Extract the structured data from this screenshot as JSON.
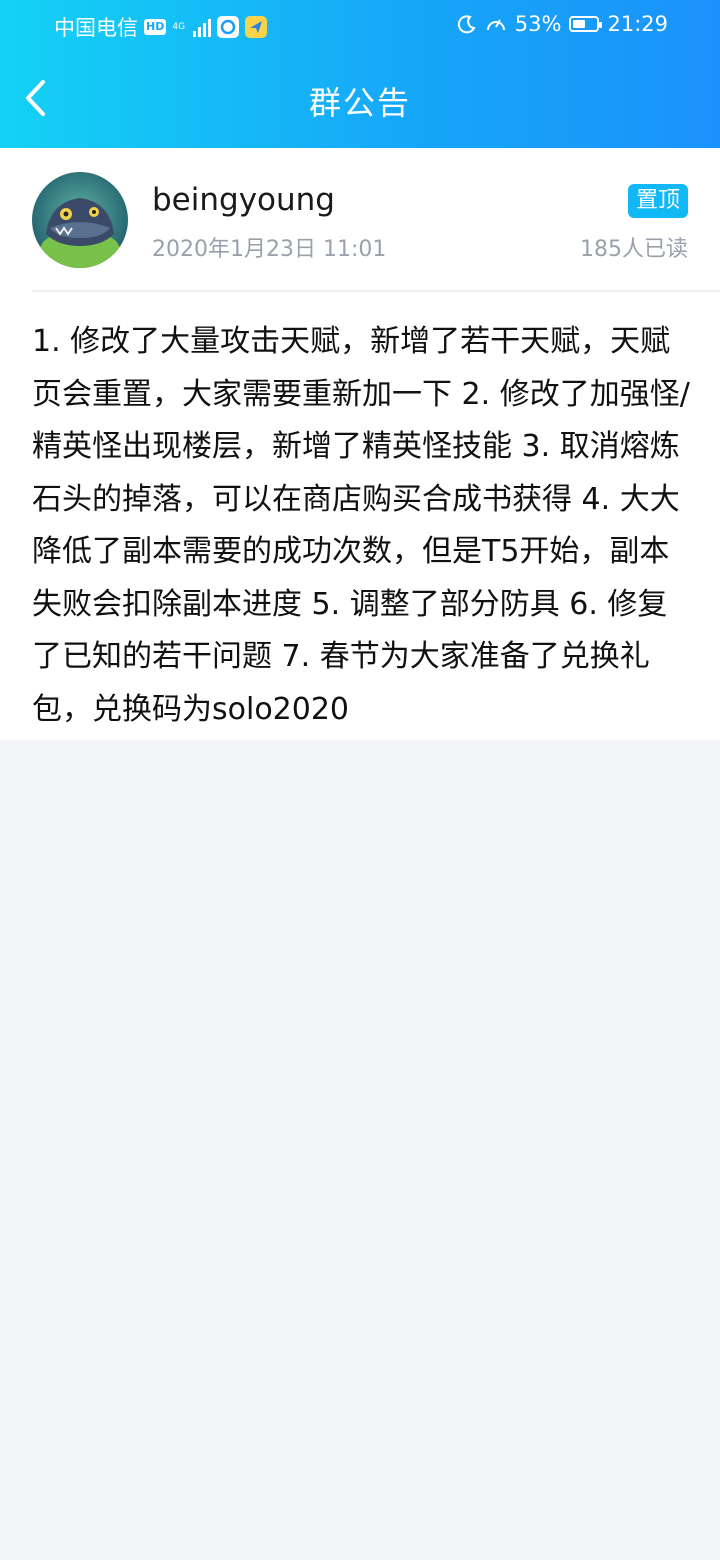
{
  "status_bar": {
    "carrier": "中国电信",
    "hd": "HD",
    "network": "4G",
    "battery_percent": "53%",
    "battery_level": 0.53,
    "time": "21:29"
  },
  "nav": {
    "title": "群公告"
  },
  "announcement": {
    "author": "beingyoung",
    "date": "2020年1月23日 11:01",
    "pinned_label": "置顶",
    "read_count": "185人已读",
    "content": "1. 修改了大量攻击天赋，新增了若干天赋，天赋页会重置，大家需要重新加一下 2. 修改了加强怪/精英怪出现楼层，新增了精英怪技能 3. 取消熔炼石头的掉落，可以在商店购买合成书获得 4. 大大降低了副本需要的成功次数，但是T5开始，副本失败会扣除副本进度 5. 调整了部分防具 6. 修复了已知的若干问题 7. 春节为大家准备了兑换礼包，兑换码为solo2020"
  },
  "colors": {
    "header_start": "#14d2f5",
    "header_end": "#1a92fb",
    "accent": "#12b7f5",
    "page_bg": "#f3f5f9"
  },
  "icons": {
    "back": "chevron-left-icon",
    "alarm": "moon-icon",
    "speed": "speedometer-icon"
  }
}
